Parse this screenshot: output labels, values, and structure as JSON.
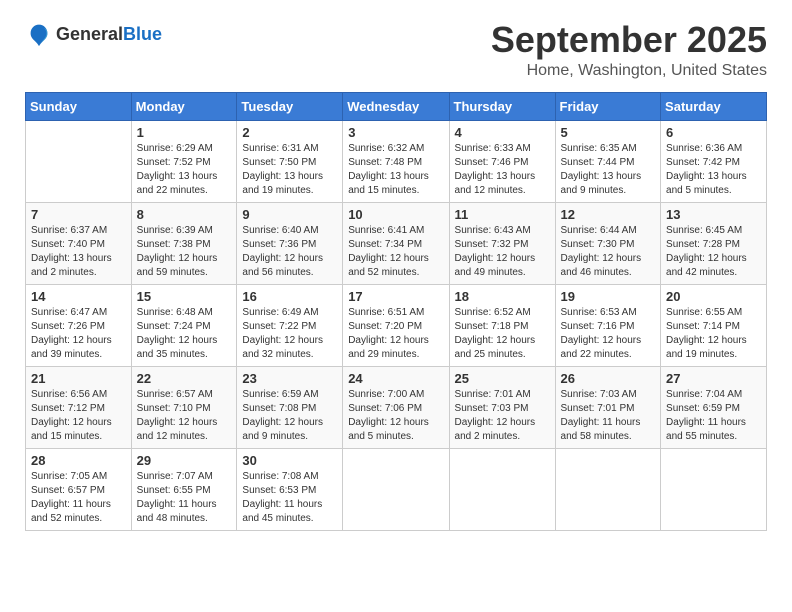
{
  "header": {
    "logo_general": "General",
    "logo_blue": "Blue",
    "month_title": "September 2025",
    "subtitle": "Home, Washington, United States"
  },
  "weekdays": [
    "Sunday",
    "Monday",
    "Tuesday",
    "Wednesday",
    "Thursday",
    "Friday",
    "Saturday"
  ],
  "weeks": [
    [
      {
        "day": "",
        "info": ""
      },
      {
        "day": "1",
        "info": "Sunrise: 6:29 AM\nSunset: 7:52 PM\nDaylight: 13 hours\nand 22 minutes."
      },
      {
        "day": "2",
        "info": "Sunrise: 6:31 AM\nSunset: 7:50 PM\nDaylight: 13 hours\nand 19 minutes."
      },
      {
        "day": "3",
        "info": "Sunrise: 6:32 AM\nSunset: 7:48 PM\nDaylight: 13 hours\nand 15 minutes."
      },
      {
        "day": "4",
        "info": "Sunrise: 6:33 AM\nSunset: 7:46 PM\nDaylight: 13 hours\nand 12 minutes."
      },
      {
        "day": "5",
        "info": "Sunrise: 6:35 AM\nSunset: 7:44 PM\nDaylight: 13 hours\nand 9 minutes."
      },
      {
        "day": "6",
        "info": "Sunrise: 6:36 AM\nSunset: 7:42 PM\nDaylight: 13 hours\nand 5 minutes."
      }
    ],
    [
      {
        "day": "7",
        "info": "Sunrise: 6:37 AM\nSunset: 7:40 PM\nDaylight: 13 hours\nand 2 minutes."
      },
      {
        "day": "8",
        "info": "Sunrise: 6:39 AM\nSunset: 7:38 PM\nDaylight: 12 hours\nand 59 minutes."
      },
      {
        "day": "9",
        "info": "Sunrise: 6:40 AM\nSunset: 7:36 PM\nDaylight: 12 hours\nand 56 minutes."
      },
      {
        "day": "10",
        "info": "Sunrise: 6:41 AM\nSunset: 7:34 PM\nDaylight: 12 hours\nand 52 minutes."
      },
      {
        "day": "11",
        "info": "Sunrise: 6:43 AM\nSunset: 7:32 PM\nDaylight: 12 hours\nand 49 minutes."
      },
      {
        "day": "12",
        "info": "Sunrise: 6:44 AM\nSunset: 7:30 PM\nDaylight: 12 hours\nand 46 minutes."
      },
      {
        "day": "13",
        "info": "Sunrise: 6:45 AM\nSunset: 7:28 PM\nDaylight: 12 hours\nand 42 minutes."
      }
    ],
    [
      {
        "day": "14",
        "info": "Sunrise: 6:47 AM\nSunset: 7:26 PM\nDaylight: 12 hours\nand 39 minutes."
      },
      {
        "day": "15",
        "info": "Sunrise: 6:48 AM\nSunset: 7:24 PM\nDaylight: 12 hours\nand 35 minutes."
      },
      {
        "day": "16",
        "info": "Sunrise: 6:49 AM\nSunset: 7:22 PM\nDaylight: 12 hours\nand 32 minutes."
      },
      {
        "day": "17",
        "info": "Sunrise: 6:51 AM\nSunset: 7:20 PM\nDaylight: 12 hours\nand 29 minutes."
      },
      {
        "day": "18",
        "info": "Sunrise: 6:52 AM\nSunset: 7:18 PM\nDaylight: 12 hours\nand 25 minutes."
      },
      {
        "day": "19",
        "info": "Sunrise: 6:53 AM\nSunset: 7:16 PM\nDaylight: 12 hours\nand 22 minutes."
      },
      {
        "day": "20",
        "info": "Sunrise: 6:55 AM\nSunset: 7:14 PM\nDaylight: 12 hours\nand 19 minutes."
      }
    ],
    [
      {
        "day": "21",
        "info": "Sunrise: 6:56 AM\nSunset: 7:12 PM\nDaylight: 12 hours\nand 15 minutes."
      },
      {
        "day": "22",
        "info": "Sunrise: 6:57 AM\nSunset: 7:10 PM\nDaylight: 12 hours\nand 12 minutes."
      },
      {
        "day": "23",
        "info": "Sunrise: 6:59 AM\nSunset: 7:08 PM\nDaylight: 12 hours\nand 9 minutes."
      },
      {
        "day": "24",
        "info": "Sunrise: 7:00 AM\nSunset: 7:06 PM\nDaylight: 12 hours\nand 5 minutes."
      },
      {
        "day": "25",
        "info": "Sunrise: 7:01 AM\nSunset: 7:03 PM\nDaylight: 12 hours\nand 2 minutes."
      },
      {
        "day": "26",
        "info": "Sunrise: 7:03 AM\nSunset: 7:01 PM\nDaylight: 11 hours\nand 58 minutes."
      },
      {
        "day": "27",
        "info": "Sunrise: 7:04 AM\nSunset: 6:59 PM\nDaylight: 11 hours\nand 55 minutes."
      }
    ],
    [
      {
        "day": "28",
        "info": "Sunrise: 7:05 AM\nSunset: 6:57 PM\nDaylight: 11 hours\nand 52 minutes."
      },
      {
        "day": "29",
        "info": "Sunrise: 7:07 AM\nSunset: 6:55 PM\nDaylight: 11 hours\nand 48 minutes."
      },
      {
        "day": "30",
        "info": "Sunrise: 7:08 AM\nSunset: 6:53 PM\nDaylight: 11 hours\nand 45 minutes."
      },
      {
        "day": "",
        "info": ""
      },
      {
        "day": "",
        "info": ""
      },
      {
        "day": "",
        "info": ""
      },
      {
        "day": "",
        "info": ""
      }
    ]
  ]
}
